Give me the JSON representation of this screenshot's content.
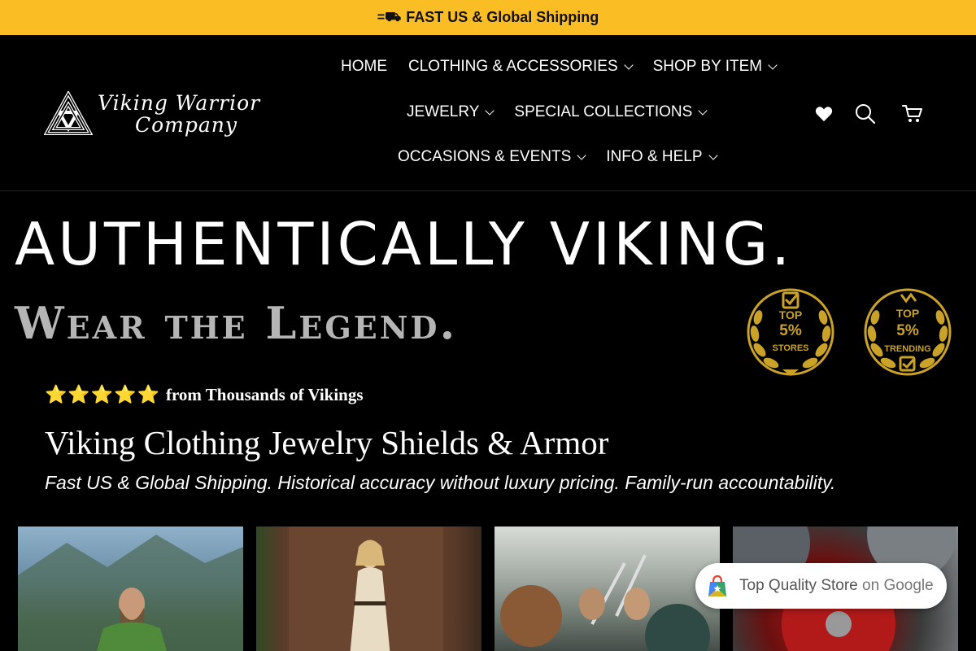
{
  "announcement": {
    "icon": "=⛟",
    "text": "FAST US & Global Shipping"
  },
  "brand": {
    "line1": "Viking Warrior",
    "line2": "Company"
  },
  "nav": {
    "row1": [
      {
        "label": "HOME",
        "has_dropdown": false
      },
      {
        "label": "CLOTHING & ACCESSORIES",
        "has_dropdown": true
      },
      {
        "label": "SHOP BY ITEM",
        "has_dropdown": true
      }
    ],
    "row2": [
      {
        "label": "JEWELRY",
        "has_dropdown": true
      },
      {
        "label": "SPECIAL COLLECTIONS",
        "has_dropdown": true
      }
    ],
    "row3": [
      {
        "label": "OCCASIONS & EVENTS",
        "has_dropdown": true
      },
      {
        "label": "INFO & HELP",
        "has_dropdown": true
      }
    ]
  },
  "header_icons": [
    "heart-icon",
    "search-icon",
    "cart-icon"
  ],
  "hero": {
    "title": "AUTHENTICALLY VIKING.",
    "subtitle": "Wear the Legend."
  },
  "badges": [
    {
      "top": "TOP",
      "value": "5%",
      "label": "STORES"
    },
    {
      "top": "TOP",
      "value": "5%",
      "label": "TRENDING"
    }
  ],
  "rating": {
    "stars": "⭐⭐⭐⭐⭐",
    "text": "from Thousands of Vikings"
  },
  "main_heading": "Viking Clothing Jewelry Shields & Armor",
  "tagline": "Fast US & Global Shipping. Historical accuracy without luxury pricing. Family-run accountability.",
  "google_badge": {
    "text": "Top Quality Store",
    "suffix": "on Google"
  },
  "colors": {
    "announcement_bg": "#fbbd24",
    "background": "#000000",
    "gold": "#c9a227",
    "star": "#f5b800"
  }
}
